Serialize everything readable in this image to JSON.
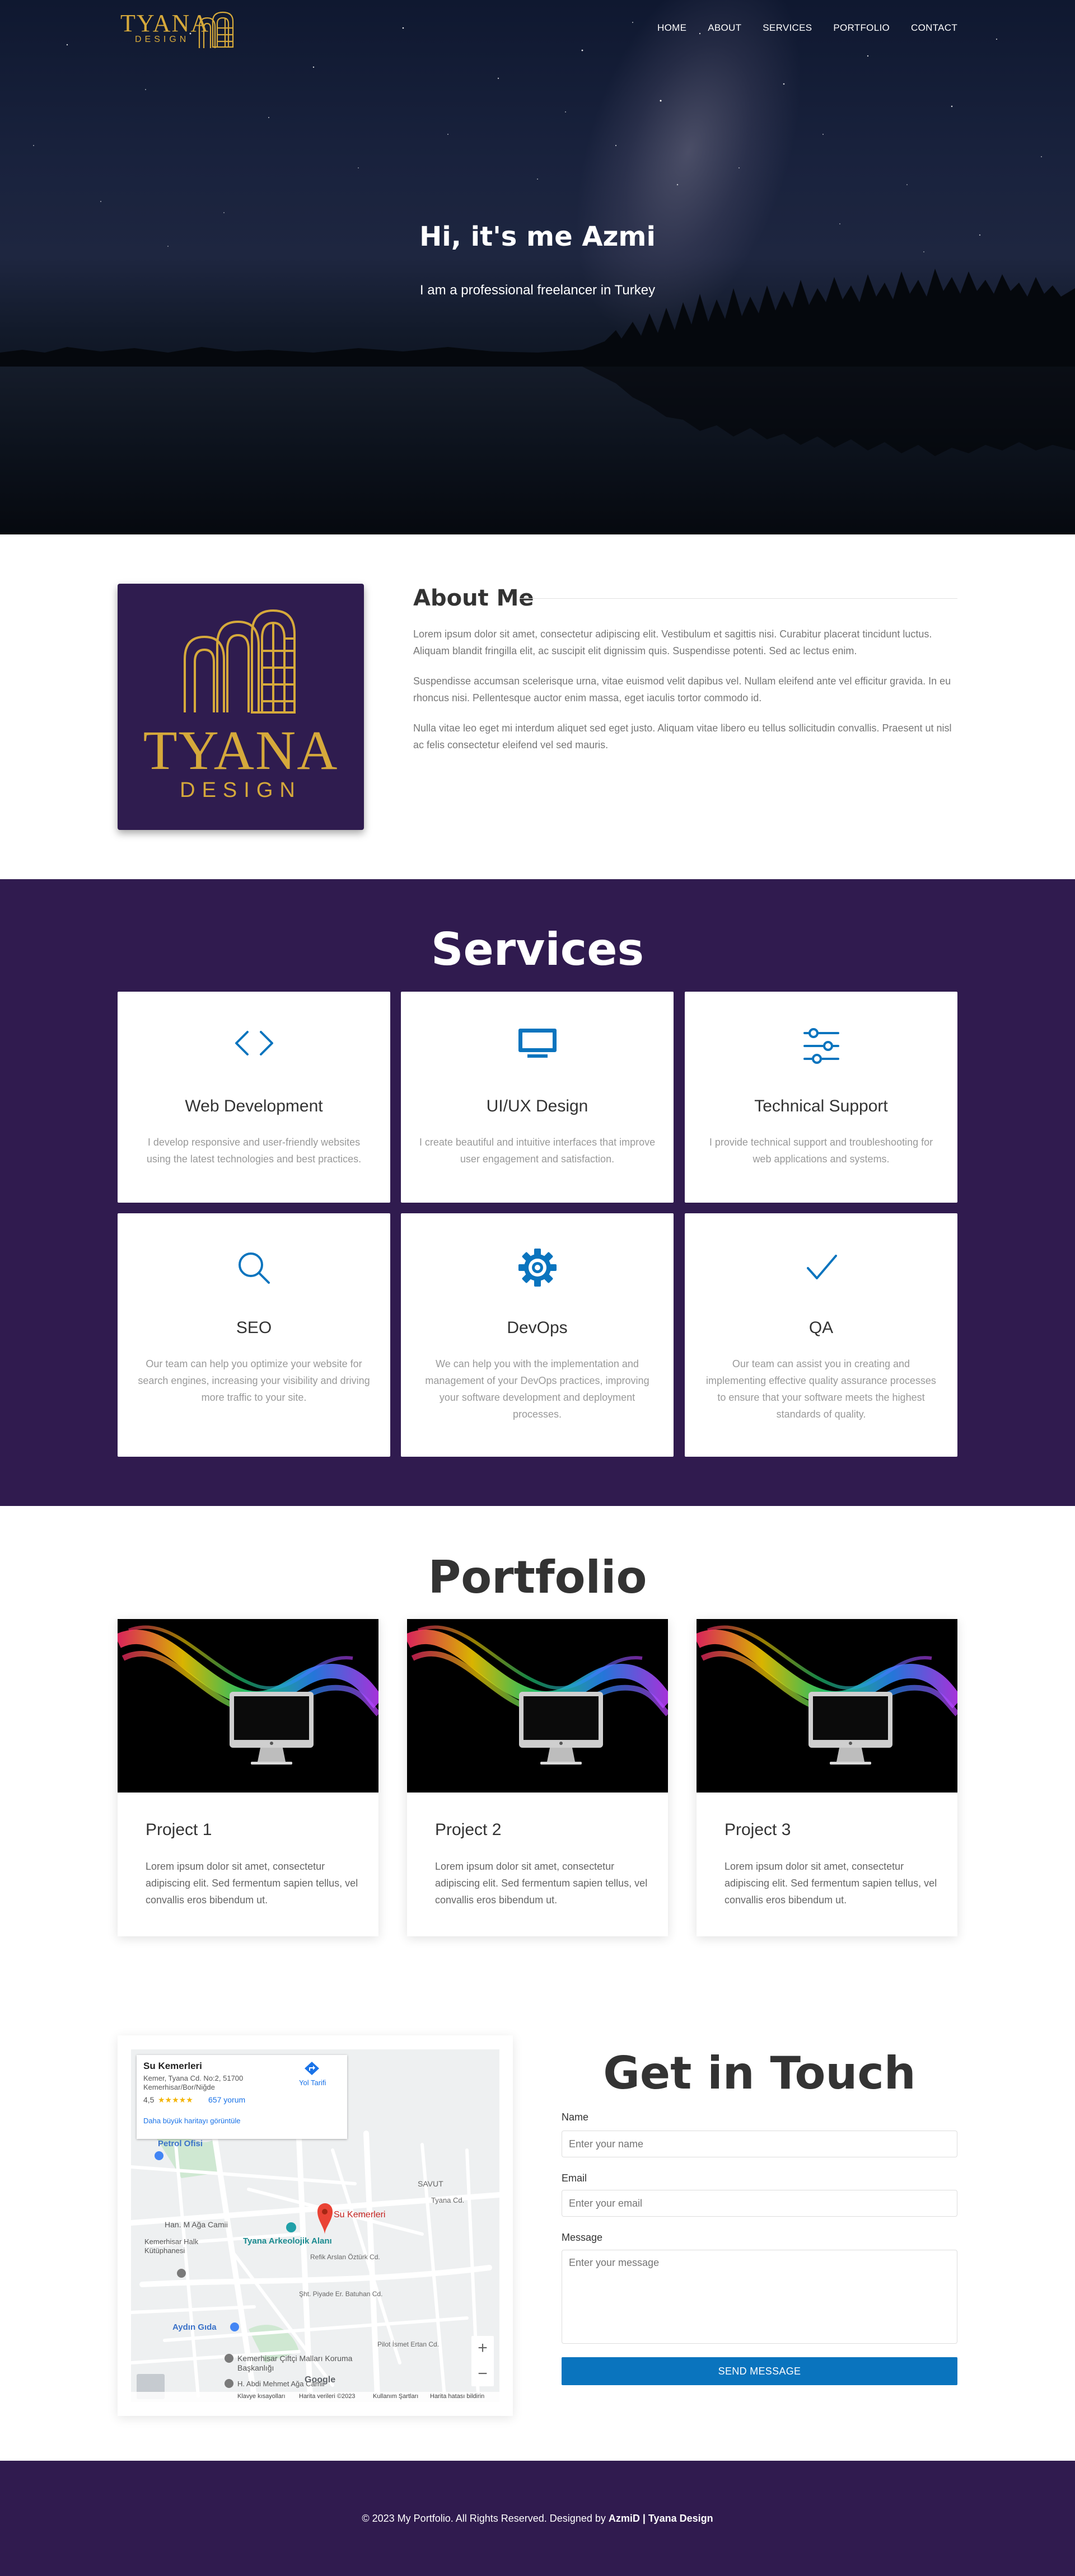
{
  "brand": {
    "name": "TYANA",
    "sub": "DESIGN",
    "accent": "#d6a93b",
    "purple": "#301b4f",
    "blue": "#0a74be"
  },
  "nav": {
    "items": [
      "HOME",
      "ABOUT",
      "SERVICES",
      "PORTFOLIO",
      "CONTACT"
    ]
  },
  "hero": {
    "title": "Hi, it's me Azmi",
    "subtitle": "I am a professional freelancer in Turkey"
  },
  "about": {
    "title": "About Me",
    "paragraphs": [
      "Lorem ipsum dolor sit amet, consectetur adipiscing elit. Vestibulum et sagittis nisi. Curabitur placerat tincidunt luctus. Aliquam blandit fringilla elit, ac suscipit elit dignissim quis. Suspendisse potenti. Sed ac lectus enim.",
      "Suspendisse accumsan scelerisque urna, vitae euismod velit dapibus vel. Nullam eleifend ante vel efficitur gravida. In eu rhoncus nisi. Pellentesque auctor enim massa, eget iaculis tortor commodo id.",
      "Nulla vitae leo eget mi interdum aliquet sed eget justo. Aliquam vitae libero eu tellus sollicitudin convallis. Praesent ut nisl ac felis consectetur eleifend vel sed mauris."
    ]
  },
  "services": {
    "title": "Services",
    "items": [
      {
        "icon": "code-icon",
        "title": "Web Development",
        "desc": "I develop responsive and user-friendly websites using the latest technologies and best practices."
      },
      {
        "icon": "monitor-icon",
        "title": "UI/UX Design",
        "desc": "I create beautiful and intuitive interfaces that improve user engagement and satisfaction."
      },
      {
        "icon": "sliders-icon",
        "title": "Technical Support",
        "desc": "I provide technical support and troubleshooting for web applications and systems."
      },
      {
        "icon": "search-icon",
        "title": "SEO",
        "desc": "Our team can help you optimize your website for search engines, increasing your visibility and driving more traffic to your site."
      },
      {
        "icon": "gear-icon",
        "title": "DevOps",
        "desc": "We can help you with the implementation and management of your DevOps practices, improving your software development and deployment processes."
      },
      {
        "icon": "check-icon",
        "title": "QA",
        "desc": "Our team can assist you in creating and implementing effective quality assurance processes to ensure that your software meets the highest standards of quality."
      }
    ]
  },
  "portfolio": {
    "title": "Portfolio",
    "items": [
      {
        "title": "Project 1",
        "desc": "Lorem ipsum dolor sit amet, consectetur adipiscing elit. Sed fermentum sapien tellus, vel convallis eros bibendum ut."
      },
      {
        "title": "Project 2",
        "desc": "Lorem ipsum dolor sit amet, consectetur adipiscing elit. Sed fermentum sapien tellus, vel convallis eros bibendum ut."
      },
      {
        "title": "Project 3",
        "desc": "Lorem ipsum dolor sit amet, consectetur adipiscing elit. Sed fermentum sapien tellus, vel convallis eros bibendum ut."
      }
    ]
  },
  "map": {
    "place": "Su Kemerleri",
    "address1": "Kemer, Tyana Cd. No:2, 51700",
    "address2": "Kemerhisar/Bor/Niğde",
    "rating": "4,5",
    "stars": "★★★★★",
    "reviews": "657 yorum",
    "directions": "Yol Tarifi",
    "larger_map": "Daha büyük haritayı görüntüle",
    "pin_label": "Su Kemerleri",
    "labels": [
      "Petrol Ofisi",
      "Han. M Ağa Camii",
      "Tyana Arkeolojik Alanı",
      "Kemerhisar Halk Kütüphanesi",
      "Aydın Gıda",
      "Kemerhisar Çiftçi Malları Koruma Başkanlığı",
      "H. Abdi Mehmet Ağa Camii",
      "SAVUT",
      "Tyana Cd.",
      "Refik Arslan Öztürk Cd.",
      "Şht. Piyade Er. Batuhan Cd.",
      "Pilot İsmet Ertan Cd."
    ],
    "footer": [
      "Klavye kısayolları",
      "Harita verileri ©2023",
      "Kullanım Şartları",
      "Harita hatası bildirin"
    ],
    "zoom_in": "+",
    "zoom_out": "−",
    "google": "Google"
  },
  "contact": {
    "title": "Get in Touch",
    "name_label": "Name",
    "name_placeholder": "Enter your name",
    "email_label": "Email",
    "email_placeholder": "Enter your email",
    "message_label": "Message",
    "message_placeholder": "Enter your message",
    "submit": "SEND MESSAGE"
  },
  "footer": {
    "text": "© 2023 My Portfolio. All Rights Reserved. Designed by ",
    "author": "AzmiD | Tyana Design"
  }
}
